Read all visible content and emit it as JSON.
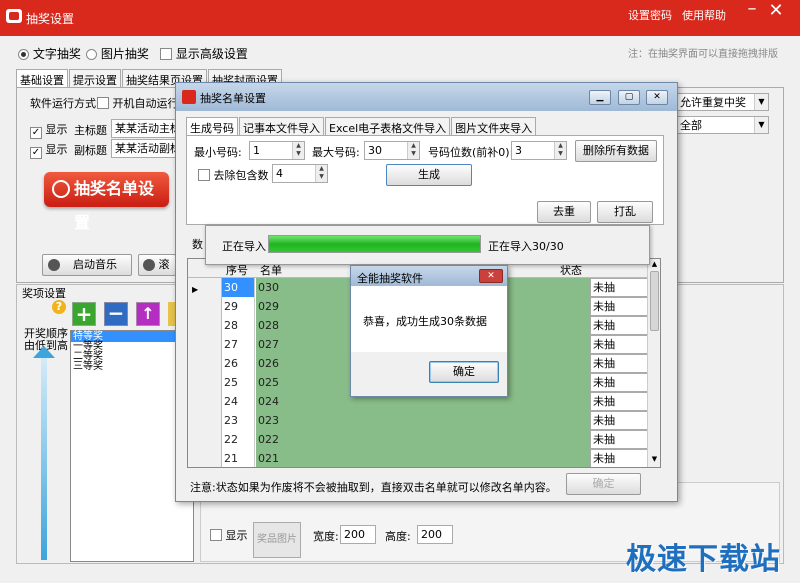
{
  "main": {
    "title": "抽奖设置",
    "links": {
      "password": "设置密码",
      "help": "使用帮助"
    },
    "mode": {
      "text": "文字抽奖",
      "image": "图片抽奖",
      "advanced": "显示高级设置"
    },
    "hint": "注：在抽奖界面可以直接拖拽排版",
    "tabs": [
      "基础设置",
      "提示设置",
      "抽奖结果页设置",
      "抽奖封面设置"
    ],
    "run_mode_label": "软件运行方式",
    "autostart": "开机自动运行",
    "show1": "显示",
    "main_title_label": "主标题",
    "main_title_value": "某某活动主标",
    "show2": "显示",
    "sub_title_label": "副标题",
    "sub_title_value": "某某活动副标",
    "list_button": "抽奖名单设置",
    "music_button": "启动音乐",
    "scroll_button": "滚",
    "right_select1": "允许重复中奖",
    "right_select2": "全部",
    "prize_label": "奖项设置",
    "order_label1": "开奖顺序",
    "order_label2": "由低到高",
    "prizes": [
      "特等奖",
      "一等奖",
      "二等奖",
      "三等奖"
    ],
    "bottom": {
      "show": "显示",
      "image_btn": "奖品图片",
      "width_label": "宽度:",
      "width_value": "200",
      "height_label": "高度:",
      "height_value": "200"
    },
    "watermark": "极速下载站"
  },
  "dialog": {
    "title": "抽奖名单设置",
    "tabs": [
      "生成号码",
      "记事本文件导入",
      "Excel电子表格文件导入",
      "图片文件夹导入"
    ],
    "min_label": "最小号码:",
    "min_value": "1",
    "max_label": "最大号码:",
    "max_value": "30",
    "digits_label": "号码位数(前补0):",
    "digits_value": "3",
    "delete_all": "删除所有数据",
    "exclude_label": "去除包含数",
    "exclude_value": "4",
    "generate": "生成",
    "dedupe": "去重",
    "shuffle": "打乱",
    "data_label": "数",
    "columns": {
      "no": "序号",
      "name": "名单",
      "status": "状态"
    },
    "rows": [
      {
        "no": "30",
        "name": "030",
        "status": "未抽"
      },
      {
        "no": "29",
        "name": "029",
        "status": "未抽"
      },
      {
        "no": "28",
        "name": "028",
        "status": "未抽"
      },
      {
        "no": "27",
        "name": "027",
        "status": "未抽"
      },
      {
        "no": "26",
        "name": "026",
        "status": "未抽"
      },
      {
        "no": "25",
        "name": "025",
        "status": "未抽"
      },
      {
        "no": "24",
        "name": "024",
        "status": "未抽"
      },
      {
        "no": "23",
        "name": "023",
        "status": "未抽"
      },
      {
        "no": "22",
        "name": "022",
        "status": "未抽"
      },
      {
        "no": "21",
        "name": "021",
        "status": "未抽"
      }
    ],
    "note": "注意:状态如果为作废将不会被抽取到，直接双击名单就可以修改名单内容。",
    "ok": "确定"
  },
  "progress": {
    "label": "正在导入",
    "status": "正在导入30/30",
    "fraction": 1.0
  },
  "message": {
    "title": "全能抽奖软件",
    "text": "恭喜，成功生成30条数据",
    "ok": "确定"
  }
}
